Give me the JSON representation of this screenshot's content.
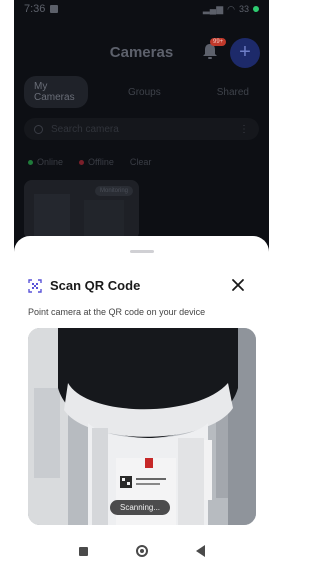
{
  "statusbar": {
    "time": "7:36",
    "battery": "33"
  },
  "header": {
    "title": "Cameras",
    "notif_badge": "99+",
    "add_label": "+"
  },
  "tabs": [
    {
      "label": "My Cameras"
    },
    {
      "label": "Groups"
    },
    {
      "label": "Shared"
    }
  ],
  "search": {
    "placeholder": "Search camera"
  },
  "filters": [
    {
      "label": "Online",
      "color": "#1f7a3a"
    },
    {
      "label": "Offline",
      "color": "#7a1f2a"
    },
    {
      "label": "Clear",
      "color": ""
    }
  ],
  "camera_card": {
    "chip": "Monitoring"
  },
  "sheet": {
    "title": "Scan QR Code",
    "subtitle": "Point camera at the QR code on your device",
    "status": "Scanning..."
  },
  "colors": {
    "accent": "#5a54d8",
    "text": "#1a1a1a"
  }
}
